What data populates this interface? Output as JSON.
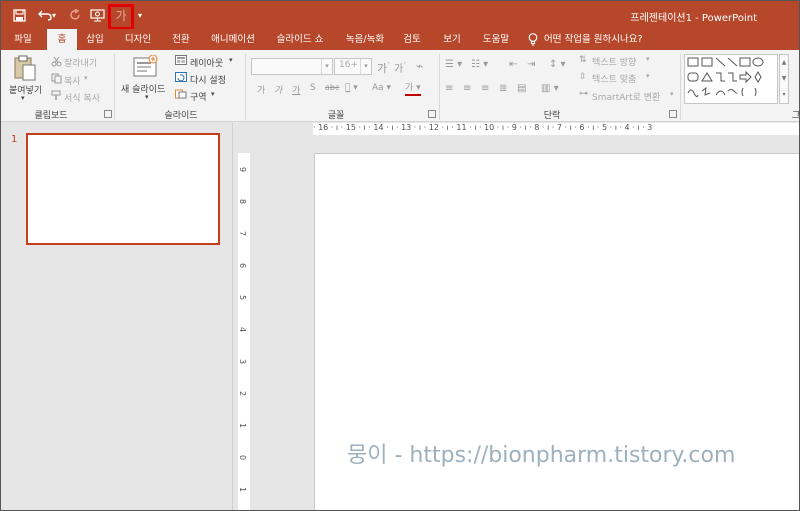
{
  "window": {
    "title": "프레젠테이션1  -  PowerPoint"
  },
  "tabs": [
    {
      "label": "파일"
    },
    {
      "label": "홈"
    },
    {
      "label": "삽입"
    },
    {
      "label": "디자인"
    },
    {
      "label": "전환"
    },
    {
      "label": "애니메이션"
    },
    {
      "label": "슬라이드 쇼"
    },
    {
      "label": "녹음/녹화"
    },
    {
      "label": "검토"
    },
    {
      "label": "보기"
    },
    {
      "label": "도움말"
    }
  ],
  "tell_me": "어떤 작업을 원하시나요?",
  "clipboard": {
    "paste": "붙여넣기",
    "cut": "잘라내기",
    "copy": "복사",
    "format_painter": "서식 복사",
    "group": "클립보드"
  },
  "slides": {
    "new_slide": "새 슬라이드",
    "layout": "레이아웃",
    "reset": "다시 설정",
    "section": "구역",
    "group": "슬라이드"
  },
  "font": {
    "size": "16+",
    "group": "글꼴",
    "case_label": "Aa",
    "color_label": "가"
  },
  "paragraph": {
    "text_direction": "텍스트 방향",
    "align_text": "텍스트 맞춤",
    "smartart": "SmartArt로 변환",
    "group": "단락"
  },
  "drawing": {
    "group_partial": "그"
  },
  "thumbnails": [
    {
      "number": "1"
    }
  ],
  "ruler": {
    "horizontal": "· 16 · ı · 15 · ı · 14 · ı · 13 · ı · 12 · ı · 11 · ı · 10 · ı · 9 · ı · 8 · ı · 7 · ı · 6 · ı · 5 · ı · 4 · ı · 3",
    "vertical": [
      "9",
      "8",
      "7",
      "6",
      "5",
      "4",
      "3",
      "2",
      "1",
      "0",
      "1"
    ]
  },
  "watermark": "뭉이 - https://bionpharm.tistory.com",
  "colors": {
    "accent": "#b7472a",
    "highlight": "#e00000"
  }
}
